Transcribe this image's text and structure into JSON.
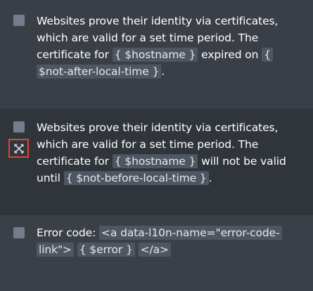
{
  "items": [
    {
      "text_before": "Websites prove their identity via certificates, which are valid for a set time period. The certificate for ",
      "placeholder_1": "{ $hostname }",
      "text_middle": " expired on ",
      "placeholder_2": "{ $not-after-local-time }",
      "text_after": "."
    },
    {
      "text_before": "Websites prove their identity via certificates, which are valid for a set time period. The certificate for ",
      "placeholder_1": "{ $hostname }",
      "text_middle": " will not be valid until ",
      "placeholder_2": "{ $not-before-local-time }",
      "text_after": "."
    },
    {
      "text_before": "Error code: ",
      "placeholder_1": "<a data-l10n-name=\"error-code-link\">",
      "placeholder_2": "{ $error }",
      "placeholder_3": "</a>"
    }
  ],
  "colors": {
    "highlight_border": "#e0452a",
    "placeholder_bg": "#4e5662",
    "checkbox": "#737d8c"
  },
  "icons": {
    "expand": "expand-arrows-icon"
  }
}
